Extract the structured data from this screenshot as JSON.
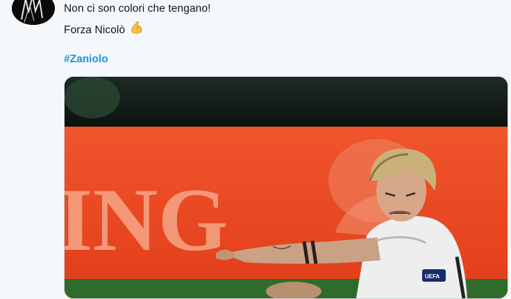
{
  "tweet": {
    "line1": "Non ci son colori che tengano!",
    "line2": "Forza Nicolò",
    "emoji_icon": "flexed-biceps-icon",
    "hashtag": "#Zaniolo",
    "hashtag_color": "#1b95e0"
  },
  "media": {
    "banner_text": "ING",
    "banner_color": "#ee4a24",
    "badge_text": "UEFA"
  }
}
